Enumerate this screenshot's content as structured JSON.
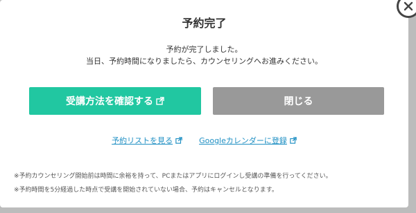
{
  "modal": {
    "title": "予約完了",
    "message_line1": "予約が完了しました。",
    "message_line2": "当日、予約時間になりましたら、カウンセリングへお進みください。",
    "primary_button_label": "受講方法を確認する",
    "close_button_label": "閉じる",
    "links": {
      "reservation_list": "予約リストを見る",
      "google_calendar": "Googleカレンダーに登録"
    },
    "notes": [
      "※予約カウンセリング開始前は時間に余裕を持って、PCまたはアプリにログインし受講の準備を行ってください。",
      "※予約時間を5分経過した時点で受講を開始されていない場合、予約はキャンセルとなります。"
    ]
  },
  "colors": {
    "primary": "#21c7a1",
    "secondary": "#999999",
    "link": "#1e8fc3"
  },
  "icons": {
    "dialog_close": "close-icon",
    "external_link": "external-link-icon"
  }
}
